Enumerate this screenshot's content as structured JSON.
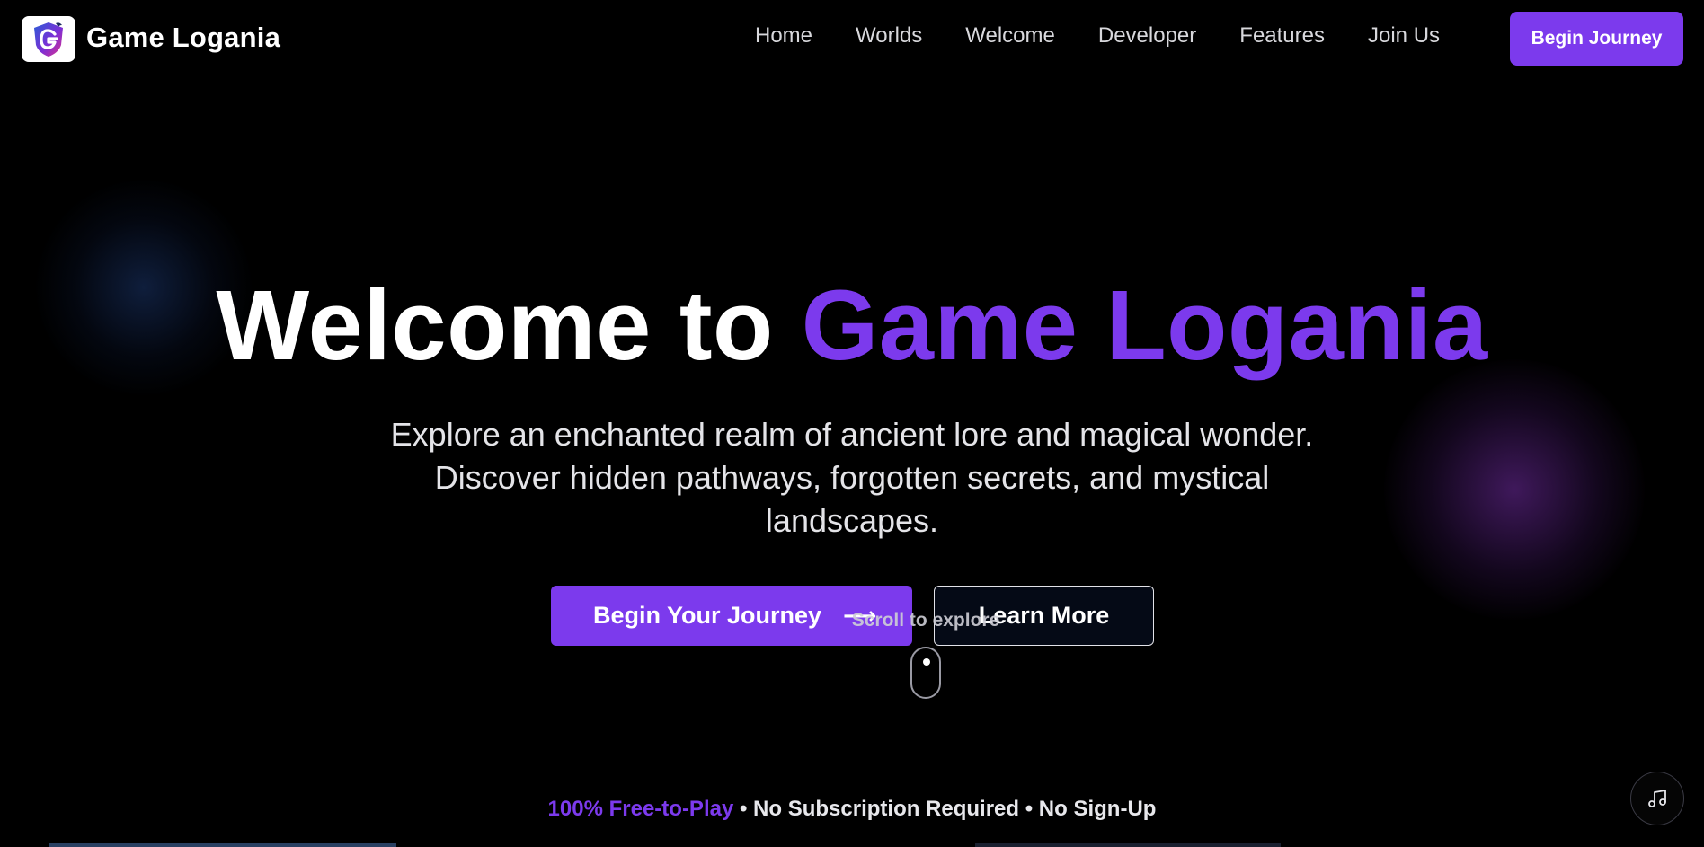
{
  "brand": {
    "name": "Game Logania",
    "logo_icon": "dragon-shield-g-logo",
    "accent_color": "#7c3aed"
  },
  "nav": {
    "links": [
      "Home",
      "Worlds",
      "Welcome",
      "Developer",
      "Features",
      "Join Us"
    ],
    "cta_label": "Begin Journey"
  },
  "hero": {
    "title_prefix": "Welcome to",
    "title_accent": "Game Logania",
    "subtitle_line1": "Explore an enchanted realm of ancient lore and magical wonder.",
    "subtitle_line2": "Discover hidden pathways, forgotten secrets, and mystical",
    "subtitle_line3": "landscapes.",
    "primary_button_label": "Begin Your Journey",
    "primary_button_icon": "arrow-right-icon",
    "secondary_button_label": "Learn More",
    "scroll_hint": "Scroll to explore"
  },
  "footer_banner": {
    "free_label": "100% Free-to-Play",
    "rest_label": " • No Subscription Required • No Sign-Up"
  },
  "music_button": {
    "icon": "music-note-icon"
  }
}
